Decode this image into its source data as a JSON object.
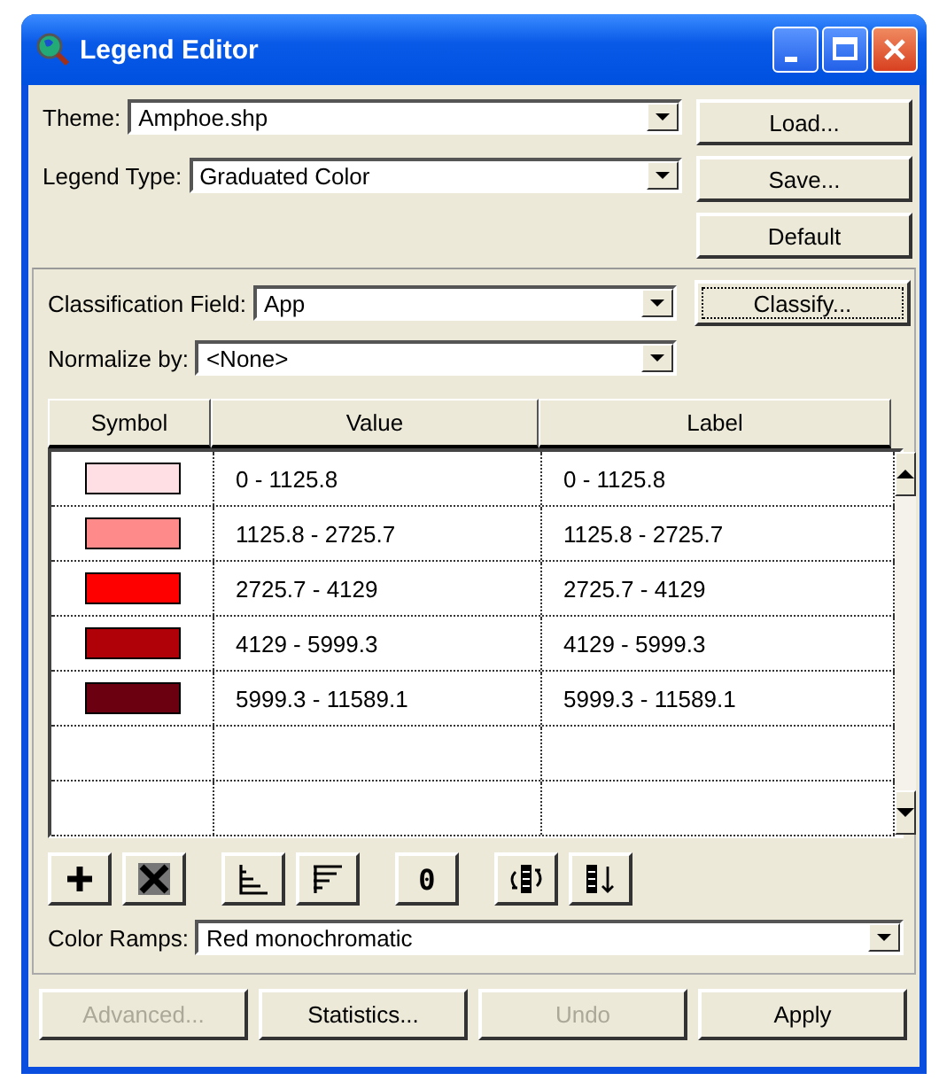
{
  "window": {
    "title": "Legend Editor"
  },
  "theme": {
    "label": "Theme:",
    "value": "Amphoe.shp"
  },
  "legend_type": {
    "label": "Legend Type:",
    "value": "Graduated Color"
  },
  "side_buttons": [
    "Load...",
    "Save...",
    "Default"
  ],
  "classification_field": {
    "label": "Classification Field:",
    "value": "App"
  },
  "classify_button": {
    "label": "Classify...",
    "focused": true
  },
  "normalize_by": {
    "label": "Normalize by:",
    "value": "<None>"
  },
  "table": {
    "columns": [
      "Symbol",
      "Value",
      "Label"
    ],
    "rows": [
      {
        "color": "#ffdfe4",
        "value": "0 - 1125.8",
        "label": "0 - 1125.8"
      },
      {
        "color": "#ff8a8a",
        "value": "1125.8 - 2725.7",
        "label": "1125.8 - 2725.7"
      },
      {
        "color": "#ff0000",
        "value": "2725.7 - 4129",
        "label": "2725.7 - 4129"
      },
      {
        "color": "#b00008",
        "value": "4129 - 5999.3",
        "label": "4129 - 5999.3"
      },
      {
        "color": "#6a0010",
        "value": "5999.3 - 11589.1",
        "label": "5999.3 - 11589.1"
      }
    ]
  },
  "tools": [
    {
      "kind": "add"
    },
    {
      "kind": "delete"
    },
    {
      "kind": "sort-asc"
    },
    {
      "kind": "sort-desc"
    },
    {
      "kind": "null",
      "glyph": "0"
    },
    {
      "kind": "flip"
    },
    {
      "kind": "reverse"
    }
  ],
  "color_ramps": {
    "label": "Color Ramps:",
    "value": "Red monochromatic"
  },
  "bottom_buttons": [
    {
      "label": "Advanced...",
      "disabled": true
    },
    {
      "label": "Statistics...",
      "disabled": false
    },
    {
      "label": "Undo",
      "disabled": true
    },
    {
      "label": "Apply",
      "disabled": false
    }
  ]
}
